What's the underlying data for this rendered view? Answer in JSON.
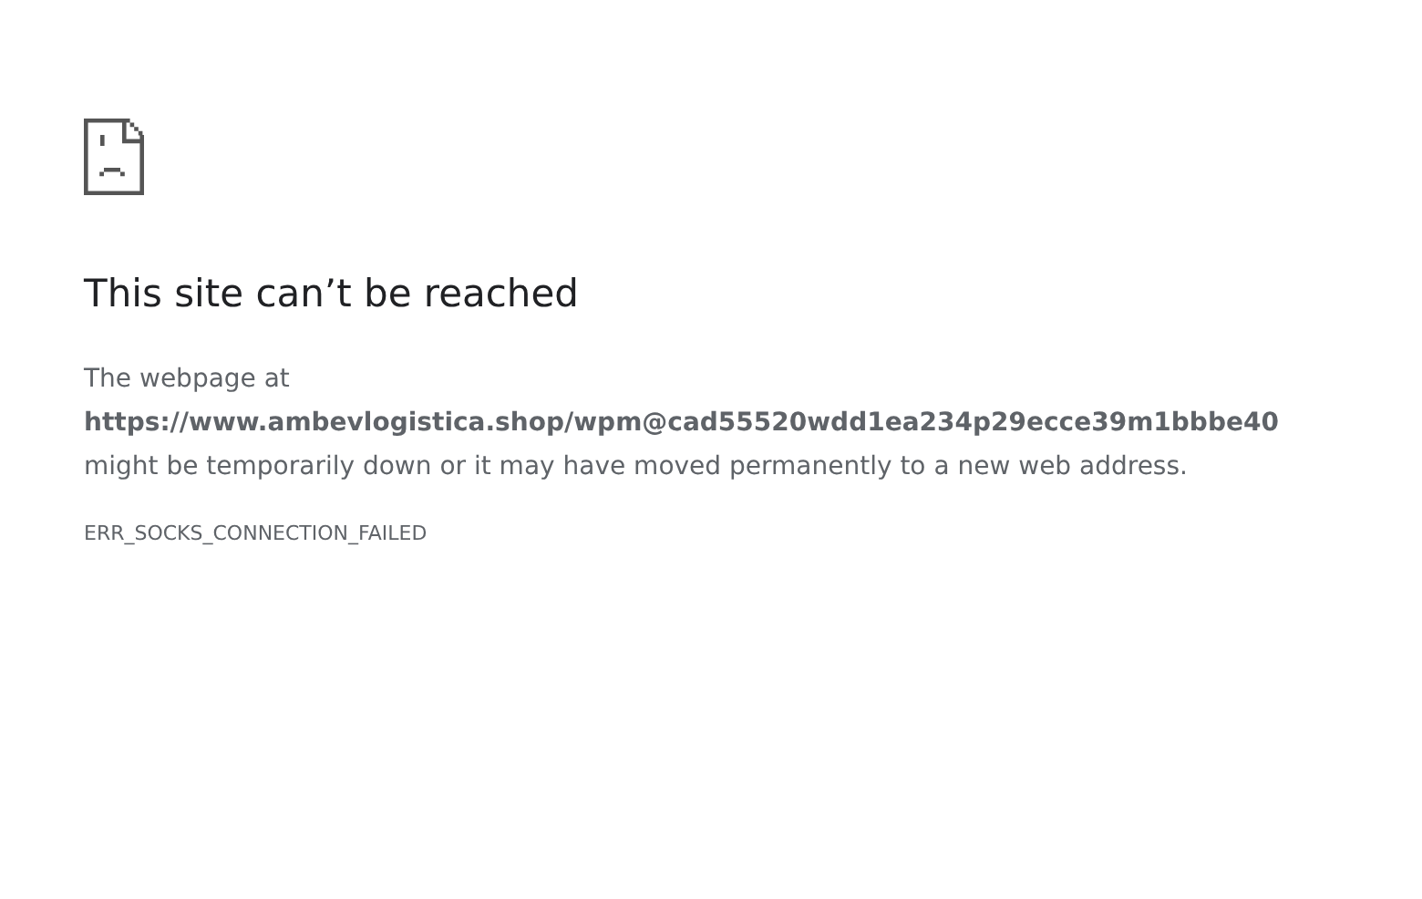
{
  "heading": "This site can’t be reached",
  "message": {
    "intro": "The webpage at",
    "url": "https://www.ambevlogistica.shop/wpm@cad55520wdd1ea234p29ecce39m1bbbe40",
    "detail": "might be temporarily down or it may have moved permanently to a new web address."
  },
  "error_code": "ERR_SOCKS_CONNECTION_FAILED"
}
